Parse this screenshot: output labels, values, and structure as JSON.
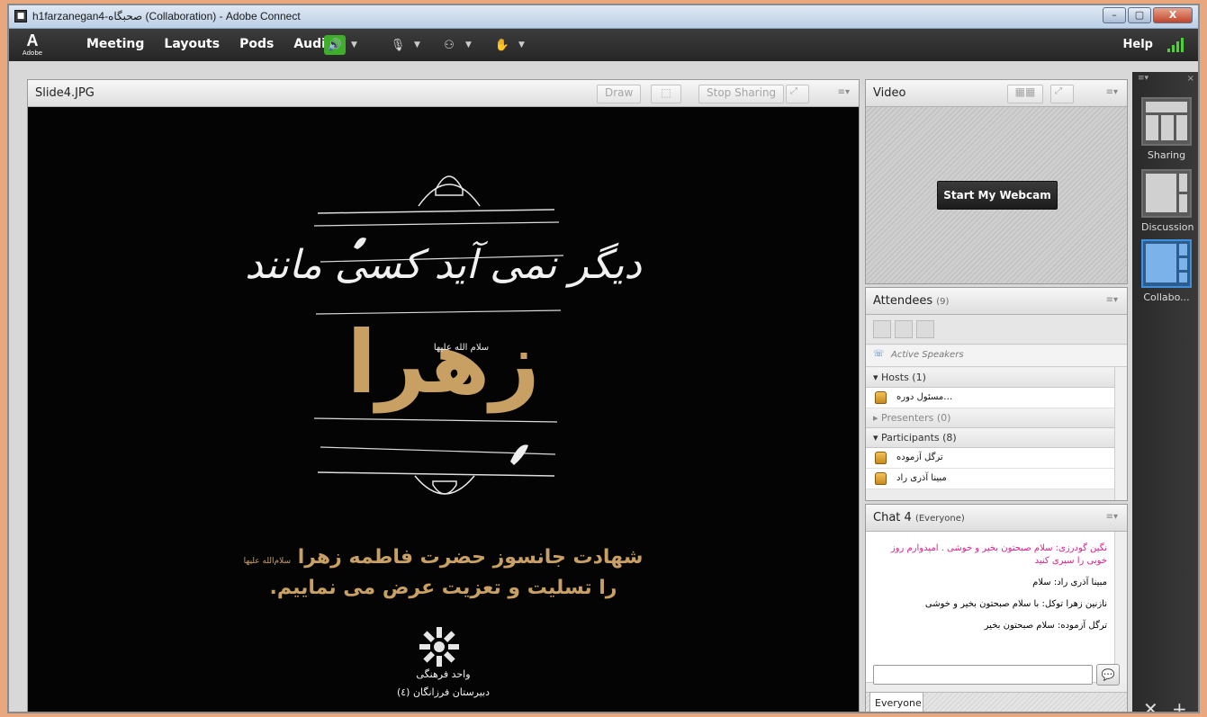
{
  "window": {
    "title": "h1farzanegan4-صحبگاه (Collaboration) - Adobe Connect",
    "buttons": {
      "minimize": "–",
      "maximize": "▢",
      "close": "X"
    }
  },
  "app": {
    "logo_letter": "A",
    "logo_text": "Adobe"
  },
  "menubar": {
    "items": [
      "Meeting",
      "Layouts",
      "Pods",
      "Audio"
    ],
    "help": "Help"
  },
  "share_pod": {
    "title": "Slide4.JPG",
    "draw_label": "Draw",
    "stop_sharing_label": "Stop Sharing",
    "menu_glyph": "≡▾",
    "poster": {
      "calligraphy_line1": "دیگر نمی آید کسی مانند",
      "calligraphy_name": "زهرا",
      "calligraphy_small": "سلام الله علیها",
      "line1": "شهادت جانسوز حضرت فاطمه زهرا",
      "line1_suffix": "سلام‌الله علیها",
      "line2": "را تسلیت و تعزیت عرض می نماییم.",
      "org1": "واحد فرهنگی",
      "org2": "دبیرستان فرزانگان (٤)"
    }
  },
  "video_pod": {
    "title": "Video",
    "start_webcam": "Start My Webcam"
  },
  "attendees_pod": {
    "title": "Attendees",
    "count": "(9)",
    "active_speakers": "Active Speakers",
    "hosts": "Hosts (1)",
    "host_name": "…مسئول دوره",
    "presenters": "Presenters (0)",
    "participants": "Participants (8)",
    "participant_names": [
      "ترگل آزموده",
      "مبینا آذری راد"
    ]
  },
  "chat_pod": {
    "title": "Chat 4",
    "audience": "(Everyone)",
    "messages": [
      {
        "text": "نگین گودرزی: سلام صبحتون بخیر و خوشی . امیدوارم روز خوبی را سپری کنید",
        "color": "#e0218a"
      },
      {
        "text": "مبینا آذری راد: سلام",
        "color": "#111111"
      },
      {
        "text": "نازنین زهرا توکل: با سلام صبحتون بخیر و خوشی",
        "color": "#111111"
      },
      {
        "text": "ترگل آزموده: سلام صبحتون بخیر",
        "color": "#111111"
      }
    ],
    "input_placeholder": "",
    "tab": "Everyone"
  },
  "layouts_rail": {
    "items": [
      {
        "label": "Sharing",
        "selected": false
      },
      {
        "label": "Discussion",
        "selected": false
      },
      {
        "label": "Collabo...",
        "selected": true
      }
    ],
    "footer_icons": [
      "tools-icon",
      "add-icon"
    ]
  },
  "colors": {
    "accent_green": "#4cd137",
    "chat_pink": "#e0218a",
    "poster_gold": "#c9a063",
    "selected_layout": "#3f8fdc"
  }
}
